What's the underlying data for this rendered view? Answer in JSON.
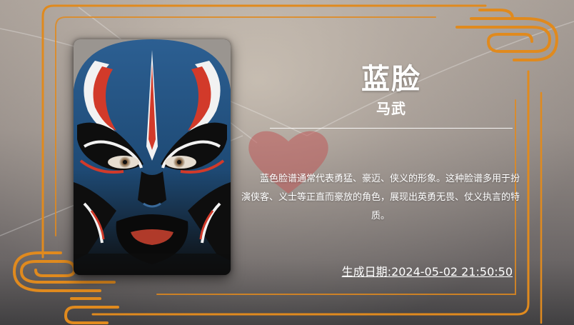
{
  "title": "蓝脸",
  "subtitle": "马武",
  "description": "蓝色脸谱通常代表勇猛、豪迈、侠义的形象。这种脸谱多用于扮演侠客、义士等正直而豪放的角色，展现出英勇无畏、仗义执言的特质。",
  "date_text": "生成日期:2024-05-02 21:50:50",
  "colors": {
    "frame_accent": "#e08a1e",
    "mask_blue": "#2f6aa0",
    "mask_red": "#c0392b",
    "heart": "#c05a5a"
  },
  "icons": {
    "mask": "peking-opera-blue-face-mask",
    "heart": "heart-icon",
    "clouds": "auspicious-cloud-ornament"
  }
}
